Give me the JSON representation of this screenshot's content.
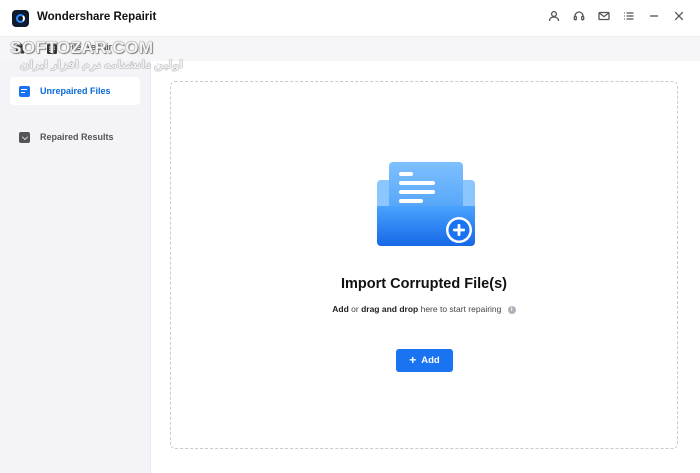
{
  "app": {
    "title": "Wondershare Repairit"
  },
  "window_controls": [
    {
      "name": "account-icon"
    },
    {
      "name": "support-headset-icon"
    },
    {
      "name": "mail-icon"
    },
    {
      "name": "menu-list-icon"
    },
    {
      "name": "minimize-icon"
    },
    {
      "name": "close-icon"
    }
  ],
  "breadcrumb": {
    "current": "File Repair"
  },
  "sidebar": {
    "items": [
      {
        "label": "Unrepaired Files",
        "active": true
      },
      {
        "label": "Repaired Results",
        "active": false
      }
    ]
  },
  "main": {
    "import_title": "Import Corrupted File(s)",
    "hint": {
      "add": "Add",
      "or": "or",
      "drag": "drag and drop",
      "rest": "here to start repairing"
    },
    "info_glyph": "i",
    "add_button": {
      "plus": "+",
      "label": "Add"
    }
  },
  "watermark": {
    "line1": "SOFTOZAR.COM",
    "line2": "اولین دانشنامه نرم افزار ایران"
  },
  "colors": {
    "accent": "#1a73f0",
    "active_text": "#0a6ad8",
    "sidebar_bg": "#f3f3f8"
  }
}
